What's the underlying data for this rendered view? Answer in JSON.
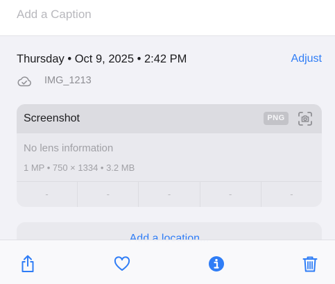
{
  "caption": {
    "placeholder": "Add a Caption"
  },
  "details": {
    "date": "Thursday • Oct 9, 2025 • 2:42 PM",
    "adjust_label": "Adjust",
    "file_name": "IMG_1213"
  },
  "card": {
    "title": "Screenshot",
    "format_badge": "PNG",
    "lens": "No lens information",
    "specs": "1 MP • 750 × 1334 • 3.2 MB",
    "exif": [
      "-",
      "-",
      "-",
      "-",
      "-"
    ]
  },
  "location": {
    "label": "Add a location..."
  },
  "toolbar": {
    "buttons": [
      {
        "name": "share",
        "icon": "share-icon"
      },
      {
        "name": "favorite",
        "icon": "heart-icon"
      },
      {
        "name": "info",
        "icon": "info-icon"
      },
      {
        "name": "delete",
        "icon": "trash-icon"
      }
    ]
  },
  "colors": {
    "accent": "#2f7df6",
    "background": "#f2f2f7",
    "card": "#e9e9ee",
    "secondary_text": "#8e8e93"
  }
}
